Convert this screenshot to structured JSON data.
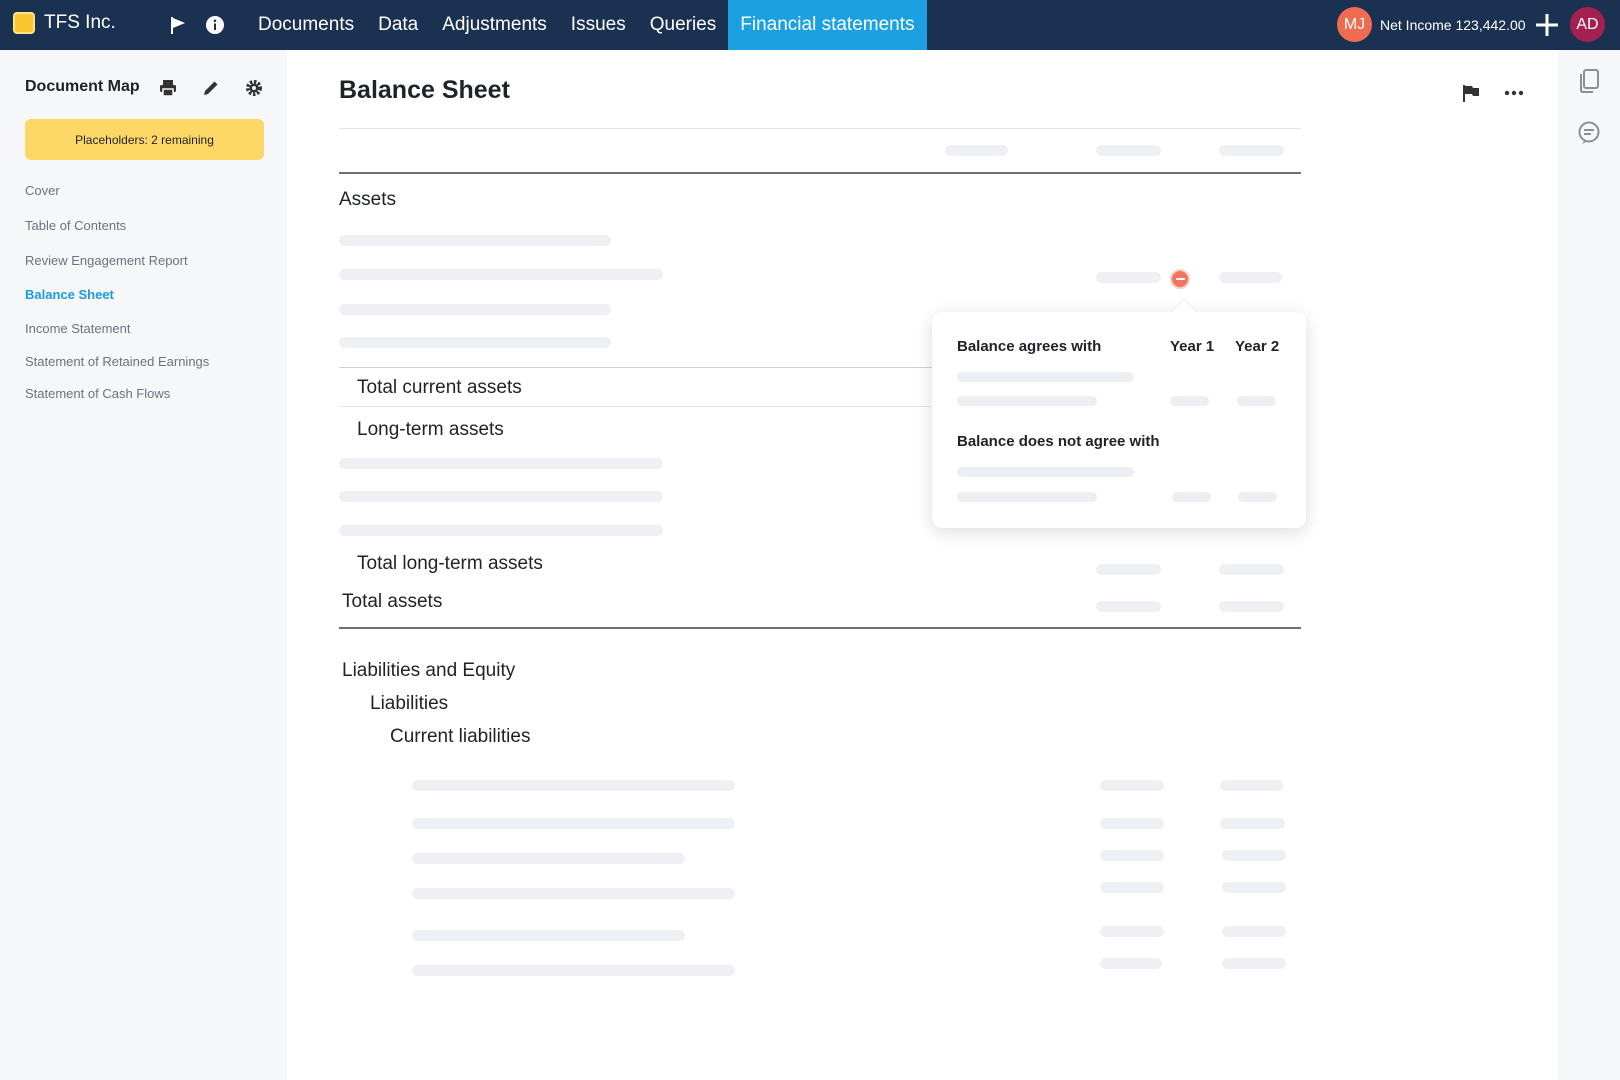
{
  "topbar": {
    "company": "TFS Inc.",
    "nav": [
      "Documents",
      "Data",
      "Adjustments",
      "Issues",
      "Queries",
      "Financial statements"
    ],
    "active_nav": "Financial statements",
    "user1_initials": "MJ",
    "net_income": "Net Income 123,442.00",
    "user2_initials": "AD"
  },
  "sidebar": {
    "title": "Document Map",
    "placeholders": "Placeholders: 2 remaining",
    "items": [
      "Cover",
      "Table of Contents",
      "Review Engagement Report",
      "Balance Sheet",
      "Income Statement",
      "Statement of Retained Earnings",
      "Statement of Cash Flows"
    ],
    "active_item": "Balance Sheet"
  },
  "main": {
    "title": "Balance Sheet",
    "assets": "Assets",
    "total_current_assets": "Total current assets",
    "long_term_assets": "Long-term assets",
    "total_long_term_assets": "Total long-term assets",
    "total_assets": "Total assets",
    "liabilities_and_equity": "Liabilities and Equity",
    "liabilities": "Liabilities",
    "current_liabilities": "Current liabilities"
  },
  "popover": {
    "agrees": "Balance agrees with",
    "year1": "Year 1",
    "year2": "Year 2",
    "not_agrees": "Balance does not agree with"
  },
  "colors": {
    "topbar": "#1b3152",
    "active_tab": "#1ba1e2",
    "placeholder_pill": "#fcd765",
    "avatar_mj": "#f06b4f",
    "avatar_ad": "#a3214e",
    "warning": "#f3735c",
    "link_active": "#1a9be3"
  },
  "icons": {
    "topbar": [
      "flag-icon",
      "info-icon",
      "plus-icon"
    ],
    "sidebar": [
      "print-icon",
      "pencil-icon",
      "gear-icon"
    ],
    "header": [
      "flag-icon",
      "more-icon"
    ],
    "rail": [
      "copy-icon",
      "comment-icon"
    ]
  }
}
